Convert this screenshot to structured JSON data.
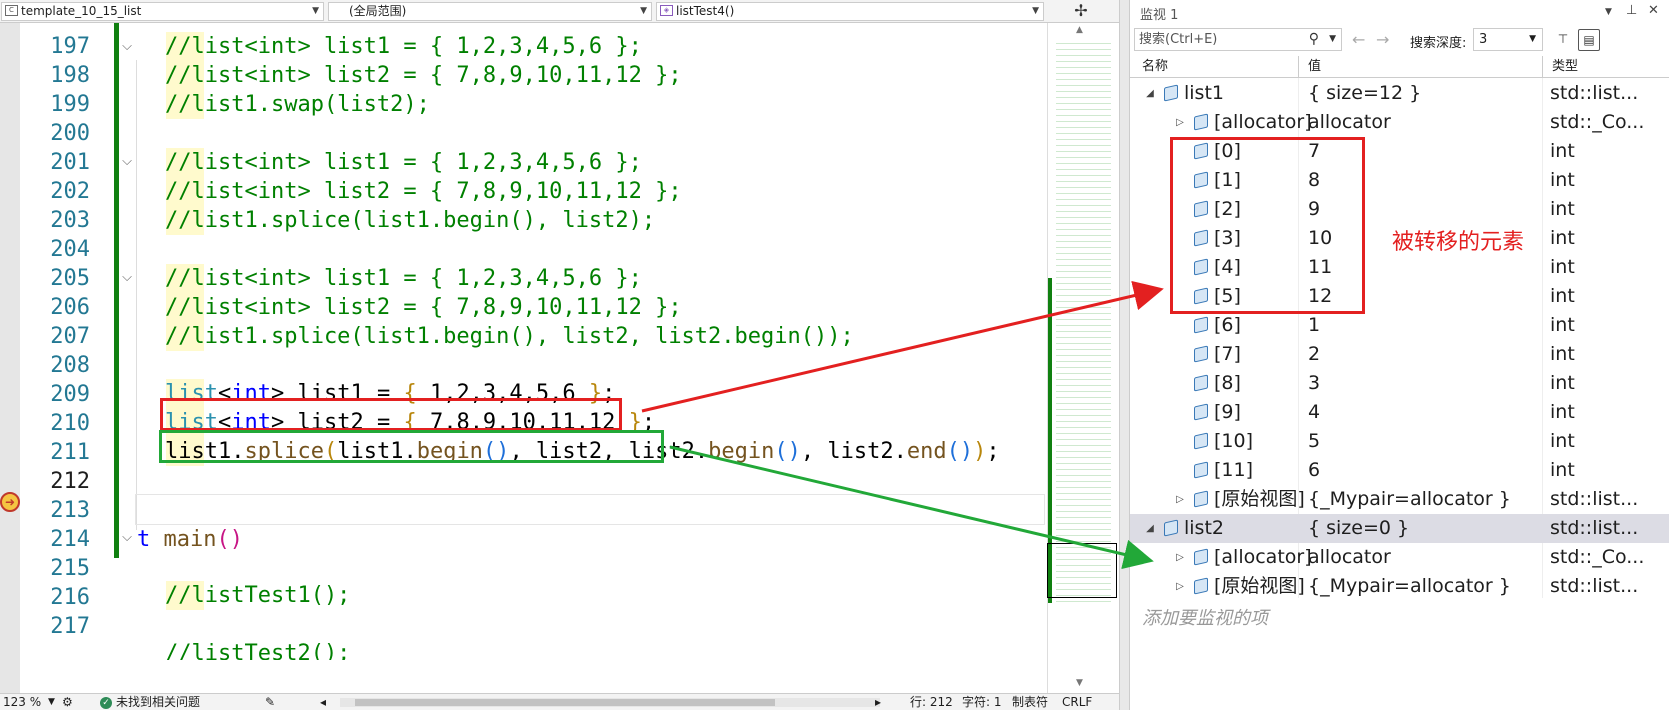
{
  "nav_bar": {
    "project": "template_10_15_list",
    "scope": "(全局范围)",
    "function": "listTest4()"
  },
  "editor": {
    "line_numbers": [
      "197",
      "198",
      "199",
      "200",
      "201",
      "202",
      "203",
      "204",
      "205",
      "206",
      "207",
      "208",
      "209",
      "210",
      "211",
      "212",
      "213",
      "214",
      "215",
      "216",
      "217"
    ],
    "lines": {
      "l197": "//list<int> list1 = { 1,2,3,4,5,6 };",
      "l198": "//list<int> list2 = { 7,8,9,10,11,12 };",
      "l199": "//list1.swap(list2);",
      "l201": "//list<int> list1 = { 1,2,3,4,5,6 };",
      "l202": "//list<int> list2 = { 7,8,9,10,11,12 };",
      "l203": "//list1.splice(list1.begin(), list2);",
      "l205": "//list<int> list1 = { 1,2,3,4,5,6 };",
      "l206": "//list<int> list2 = { 7,8,9,10,11,12 };",
      "l207": "//list1.splice(list1.begin(), list2, list2.begin());",
      "l216": "//listTest1();",
      "l217": "//listTest2();"
    },
    "code209": {
      "ty": "list",
      "lt": "<",
      "kw": "int",
      "gt": ">",
      "rest": " list1 = ",
      "ob": "{",
      "nums": " 1,2,3,4,5,6 ",
      "cb": "}",
      "end": ";"
    },
    "code210": {
      "ty": "list",
      "lt": "<",
      "kw": "int",
      "gt": ">",
      "rest": " list2 = ",
      "ob": "{",
      "nums": " 7,8,9,10,11,12 ",
      "cb": "}",
      "end": ";"
    },
    "code211": {
      "a": "list1.",
      "b": "splice",
      "c": "(",
      "d": "list1.",
      "e": "begin",
      "f": "()",
      "g": ", list2, list2.",
      "h": "begin",
      "i": "()",
      "j": ", list2.",
      "k": "end",
      "l": "()",
      "m": ")",
      "n": ";"
    },
    "code214": {
      "t": "t",
      "fn": " main",
      "p": "()"
    }
  },
  "status_bar": {
    "zoom": "123 %",
    "issues": "未找到相关问题",
    "line": "行: 212",
    "char": "字符: 1",
    "tabs": "制表符",
    "eol": "CRLF"
  },
  "watch": {
    "title": "监视 1",
    "search_placeholder": "搜索(Ctrl+E)",
    "depth_label": "搜索深度:",
    "depth_value": "3",
    "columns": {
      "name": "名称",
      "value": "值",
      "type": "类型"
    },
    "rows": [
      {
        "name": "list1",
        "value": "{ size=12 }",
        "type": "std::list..."
      },
      {
        "name": "[allocator]",
        "value": "allocator",
        "type": "std::_Co..."
      },
      {
        "name": "[0]",
        "value": "7",
        "type": "int"
      },
      {
        "name": "[1]",
        "value": "8",
        "type": "int"
      },
      {
        "name": "[2]",
        "value": "9",
        "type": "int"
      },
      {
        "name": "[3]",
        "value": "10",
        "type": "int"
      },
      {
        "name": "[4]",
        "value": "11",
        "type": "int"
      },
      {
        "name": "[5]",
        "value": "12",
        "type": "int"
      },
      {
        "name": "[6]",
        "value": "1",
        "type": "int"
      },
      {
        "name": "[7]",
        "value": "2",
        "type": "int"
      },
      {
        "name": "[8]",
        "value": "3",
        "type": "int"
      },
      {
        "name": "[9]",
        "value": "4",
        "type": "int"
      },
      {
        "name": "[10]",
        "value": "5",
        "type": "int"
      },
      {
        "name": "[11]",
        "value": "6",
        "type": "int"
      },
      {
        "name": "[原始视图]",
        "value": "{_Mypair=allocator }",
        "type": "std::list..."
      },
      {
        "name": "list2",
        "value": "{ size=0 }",
        "type": "std::list..."
      },
      {
        "name": "[allocator]",
        "value": "allocator",
        "type": "std::_Co..."
      },
      {
        "name": "[原始视图]",
        "value": "{_Mypair=allocator }",
        "type": "std::list..."
      }
    ],
    "add_watch": "添加要监视的项"
  },
  "annotation": {
    "label": "被转移的元素",
    "colors": {
      "red": "#e32020",
      "green": "#22a838"
    }
  }
}
